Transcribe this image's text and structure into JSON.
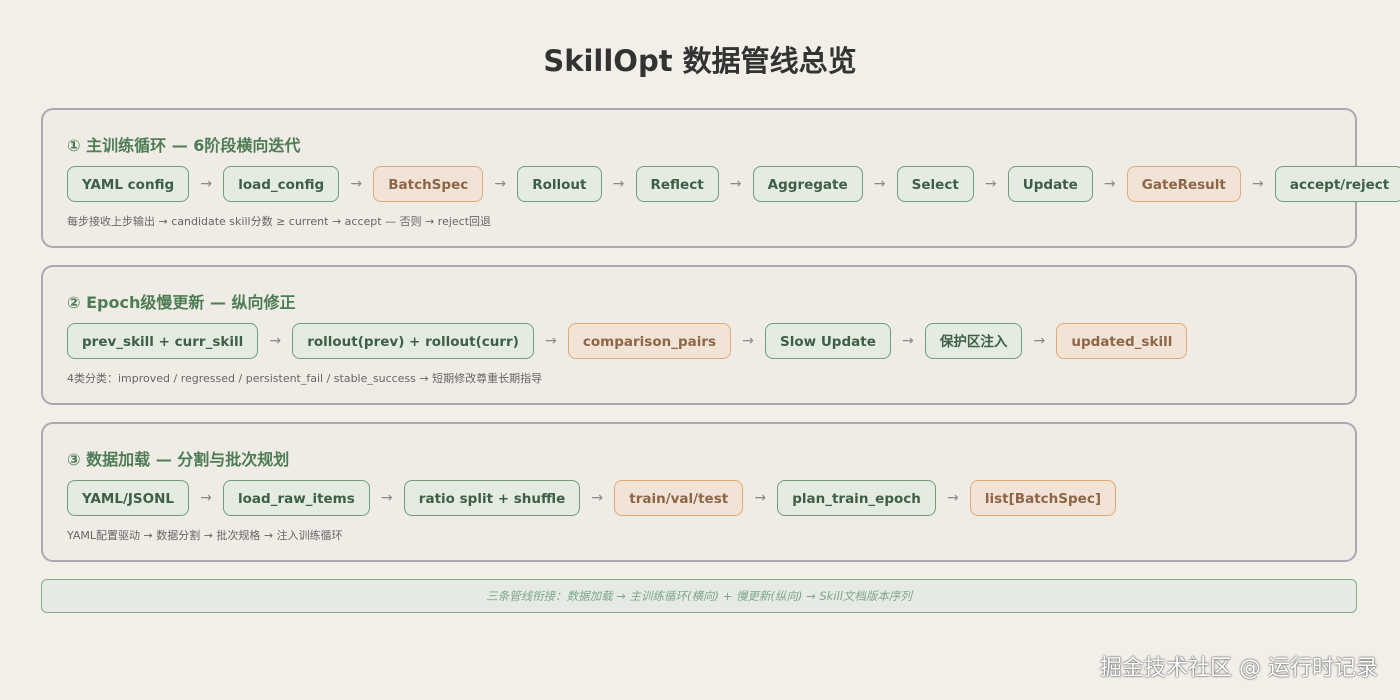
{
  "title": "SkillOpt 数据管线总览",
  "panels": [
    {
      "title": "① 主训练循环 — 6阶段横向迭代",
      "nodes": [
        {
          "label": "YAML config",
          "style": "green"
        },
        {
          "label": "load_config",
          "style": "green"
        },
        {
          "label": "BatchSpec",
          "style": "orange"
        },
        {
          "label": "Rollout",
          "style": "green"
        },
        {
          "label": "Reflect",
          "style": "green"
        },
        {
          "label": "Aggregate",
          "style": "green"
        },
        {
          "label": "Select",
          "style": "green"
        },
        {
          "label": "Update",
          "style": "green"
        },
        {
          "label": "GateResult",
          "style": "orange"
        },
        {
          "label": "accept/reject",
          "style": "green"
        }
      ],
      "note": "每步接收上步输出 → candidate skill分数 ≥ current → accept — 否则 → reject回退"
    },
    {
      "title": "② Epoch级慢更新 — 纵向修正",
      "nodes": [
        {
          "label": "prev_skill + curr_skill",
          "style": "green"
        },
        {
          "label": "rollout(prev) + rollout(curr)",
          "style": "green"
        },
        {
          "label": "comparison_pairs",
          "style": "orange"
        },
        {
          "label": "Slow Update",
          "style": "green"
        },
        {
          "label": "保护区注入",
          "style": "green"
        },
        {
          "label": "updated_skill",
          "style": "orange"
        }
      ],
      "note": "4类分类：improved / regressed / persistent_fail / stable_success → 短期修改尊重长期指导"
    },
    {
      "title": "③ 数据加载 — 分割与批次规划",
      "nodes": [
        {
          "label": "YAML/JSONL",
          "style": "green"
        },
        {
          "label": "load_raw_items",
          "style": "green"
        },
        {
          "label": "ratio split + shuffle",
          "style": "green"
        },
        {
          "label": "train/val/test",
          "style": "orange"
        },
        {
          "label": "plan_train_epoch",
          "style": "green"
        },
        {
          "label": "list[BatchSpec]",
          "style": "orange"
        }
      ],
      "note": "YAML配置驱动 → 数据分割 → 批次规格 → 注入训练循环"
    }
  ],
  "arrow_glyph": "→",
  "footer": "三条管线衔接：数据加载 → 主训练循环(横向) + 慢更新(纵向) → Skill文档版本序列",
  "watermark": "掘金技术社区 @ 运行时记录",
  "colors": {
    "green_border": "#6e9f78",
    "green_fill": "#e4ebe1",
    "orange_border": "#e4a874",
    "orange_fill": "#f1e4d6",
    "title_green": "#4e7d55"
  }
}
